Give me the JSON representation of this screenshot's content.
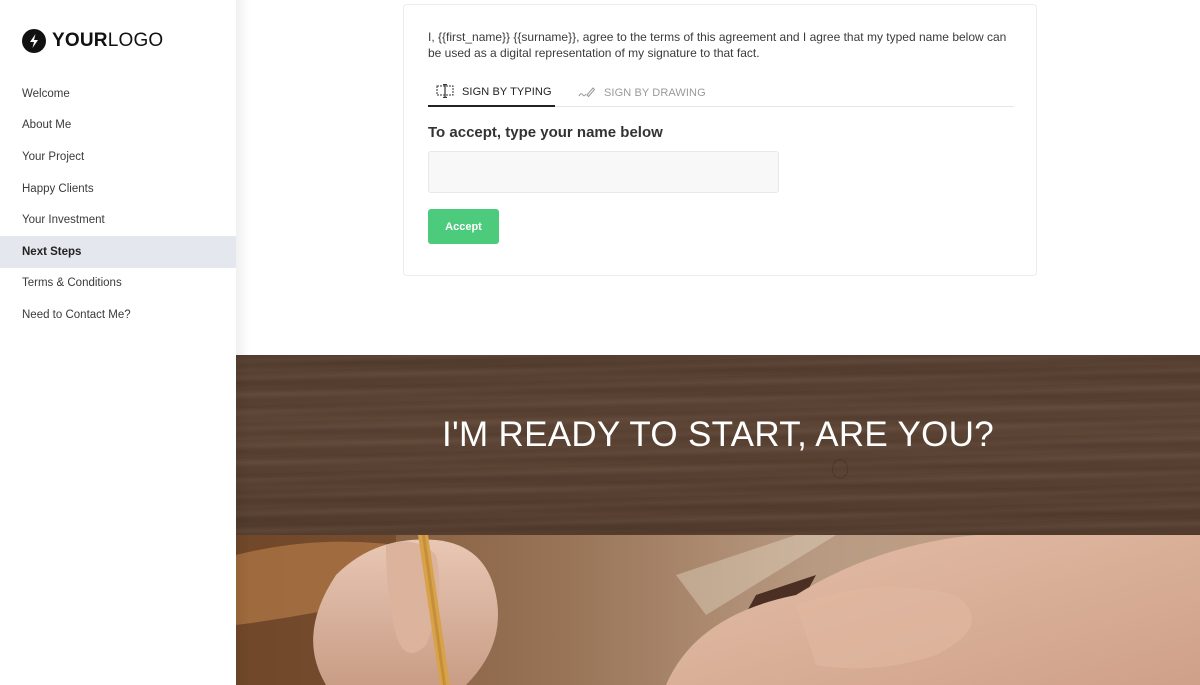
{
  "sidebar": {
    "logo": {
      "icon": "lightning-bolt-icon",
      "bold": "YOUR",
      "light": "LOGO"
    },
    "items": [
      {
        "label": "Welcome",
        "active": false
      },
      {
        "label": "About Me",
        "active": false
      },
      {
        "label": "Your Project",
        "active": false
      },
      {
        "label": "Happy Clients",
        "active": false
      },
      {
        "label": "Your Investment",
        "active": false
      },
      {
        "label": "Next Steps",
        "active": true
      },
      {
        "label": "Terms & Conditions",
        "active": false
      },
      {
        "label": "Need to Contact Me?",
        "active": false
      }
    ]
  },
  "signature": {
    "agreement_text": "I, {{first_name}} {{surname}}, agree to the terms of this agreement and I agree that my typed name below can be used as a digital representation of my signature to that fact.",
    "tabs": [
      {
        "label": "SIGN BY TYPING",
        "icon": "text-cursor-icon",
        "active": true
      },
      {
        "label": "SIGN BY DRAWING",
        "icon": "pen-signature-icon",
        "active": false
      }
    ],
    "heading": "To accept, type your name below",
    "input": {
      "value": "",
      "placeholder": ""
    },
    "accept_label": "Accept",
    "accept_color": "#4ccb7d"
  },
  "banner": {
    "title": "I'M READY TO START, ARE YOU?"
  },
  "photo": {
    "description": "hands-holding-pencil-woodworking"
  },
  "colors": {
    "active_nav_bg": "#e4e7ed",
    "banner_wood": "#5a4132",
    "accent_green": "#4ccb7d"
  }
}
